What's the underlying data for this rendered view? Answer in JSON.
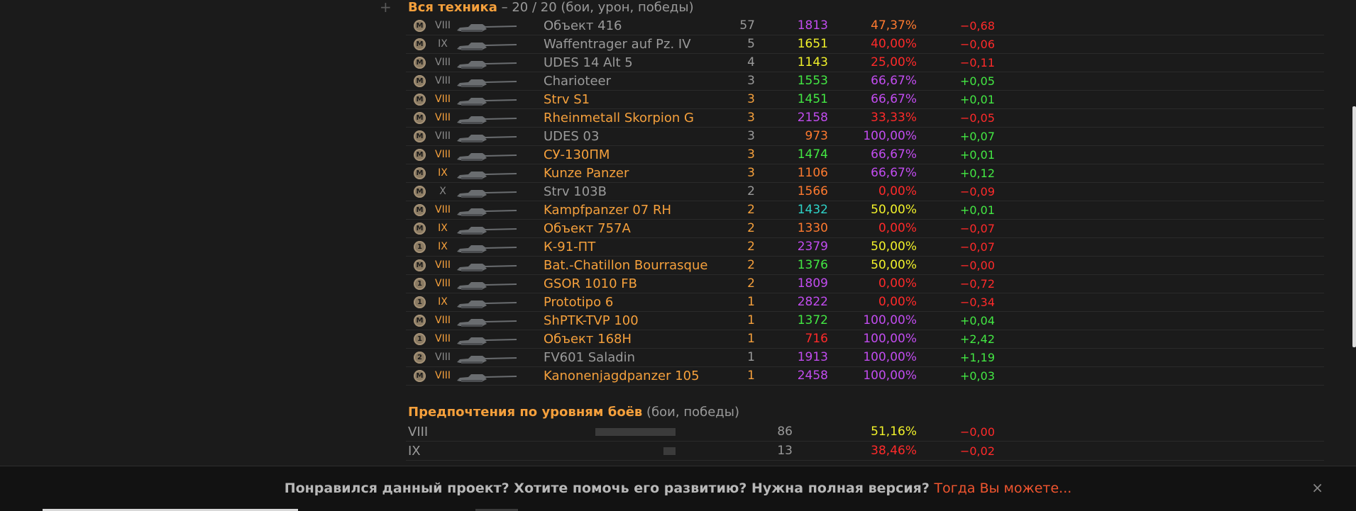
{
  "vehicles_section": {
    "plus_icon": "plus",
    "title": "Вся техника",
    "subtitle": " – 20 / 20 (бои, урон, победы)"
  },
  "vehicles": [
    {
      "medal": "M",
      "tier": "VIII",
      "name": "Объект 416",
      "battles": "57",
      "damage": "1813",
      "winrate": "47,37%",
      "delta": "−0,68",
      "colors": {
        "name": "gray",
        "battles": "gray",
        "damage": "purple",
        "winrate": "orange",
        "delta": "red"
      }
    },
    {
      "medal": "M",
      "tier": "IX",
      "name": "Waffentrager auf Pz. IV",
      "battles": "5",
      "damage": "1651",
      "winrate": "40,00%",
      "delta": "−0,06",
      "colors": {
        "name": "gray",
        "battles": "gray",
        "damage": "yellow",
        "winrate": "red",
        "delta": "red"
      }
    },
    {
      "medal": "M",
      "tier": "VIII",
      "name": "UDES 14 Alt 5",
      "battles": "4",
      "damage": "1143",
      "winrate": "25,00%",
      "delta": "−0,11",
      "colors": {
        "name": "gray",
        "battles": "gray",
        "damage": "yellow",
        "winrate": "red",
        "delta": "red"
      }
    },
    {
      "medal": "M",
      "tier": "VIII",
      "name": "Charioteer",
      "battles": "3",
      "damage": "1553",
      "winrate": "66,67%",
      "delta": "+0,05",
      "colors": {
        "name": "gray",
        "battles": "gray",
        "damage": "green",
        "winrate": "purple",
        "delta": "green"
      }
    },
    {
      "medal": "M",
      "tier": "VIII",
      "name": "Strv S1",
      "battles": "3",
      "damage": "1451",
      "winrate": "66,67%",
      "delta": "+0,01",
      "colors": {
        "name": "orange",
        "battles": "orange",
        "damage": "green",
        "winrate": "purple",
        "delta": "green"
      }
    },
    {
      "medal": "M",
      "tier": "VIII",
      "name": "Rheinmetall Skorpion G",
      "battles": "3",
      "damage": "2158",
      "winrate": "33,33%",
      "delta": "−0,05",
      "colors": {
        "name": "orange",
        "battles": "orange",
        "damage": "purple",
        "winrate": "red",
        "delta": "red"
      }
    },
    {
      "medal": "M",
      "tier": "VIII",
      "name": "UDES 03",
      "battles": "3",
      "damage": "973",
      "winrate": "100,00%",
      "delta": "+0,07",
      "colors": {
        "name": "gray",
        "battles": "gray",
        "damage": "orange",
        "winrate": "purple",
        "delta": "green"
      }
    },
    {
      "medal": "M",
      "tier": "VIII",
      "name": "СУ-130ПМ",
      "battles": "3",
      "damage": "1474",
      "winrate": "66,67%",
      "delta": "+0,01",
      "colors": {
        "name": "orange",
        "battles": "orange",
        "damage": "green",
        "winrate": "purple",
        "delta": "green"
      }
    },
    {
      "medal": "M",
      "tier": "IX",
      "name": "Kunze Panzer",
      "battles": "3",
      "damage": "1106",
      "winrate": "66,67%",
      "delta": "+0,12",
      "colors": {
        "name": "orange",
        "battles": "orange",
        "damage": "orange",
        "winrate": "purple",
        "delta": "green"
      }
    },
    {
      "medal": "M",
      "tier": "X",
      "name": "Strv 103B",
      "battles": "2",
      "damage": "1566",
      "winrate": "0,00%",
      "delta": "−0,09",
      "colors": {
        "name": "gray",
        "battles": "gray",
        "damage": "orange",
        "winrate": "red",
        "delta": "red"
      }
    },
    {
      "medal": "M",
      "tier": "VIII",
      "name": "Kampfpanzer 07 RH",
      "battles": "2",
      "damage": "1432",
      "winrate": "50,00%",
      "delta": "+0,01",
      "colors": {
        "name": "orange",
        "battles": "orange",
        "damage": "teal",
        "winrate": "yellow",
        "delta": "green"
      }
    },
    {
      "medal": "M",
      "tier": "IX",
      "name": "Объект 757А",
      "battles": "2",
      "damage": "1330",
      "winrate": "0,00%",
      "delta": "−0,07",
      "colors": {
        "name": "orange",
        "battles": "orange",
        "damage": "orange",
        "winrate": "red",
        "delta": "red"
      }
    },
    {
      "medal": "1",
      "tier": "IX",
      "name": "К-91-ПТ",
      "battles": "2",
      "damage": "2379",
      "winrate": "50,00%",
      "delta": "−0,07",
      "colors": {
        "name": "orange",
        "battles": "orange",
        "damage": "purple",
        "winrate": "yellow",
        "delta": "red"
      }
    },
    {
      "medal": "M",
      "tier": "VIII",
      "name": "Bat.-Chatillon Bourrasque",
      "battles": "2",
      "damage": "1376",
      "winrate": "50,00%",
      "delta": "−0,00",
      "colors": {
        "name": "orange",
        "battles": "orange",
        "damage": "green",
        "winrate": "yellow",
        "delta": "red"
      }
    },
    {
      "medal": "1",
      "tier": "VIII",
      "name": "GSOR 1010 FB",
      "battles": "2",
      "damage": "1809",
      "winrate": "0,00%",
      "delta": "−0,72",
      "colors": {
        "name": "orange",
        "battles": "orange",
        "damage": "purple",
        "winrate": "red",
        "delta": "red"
      }
    },
    {
      "medal": "1",
      "tier": "IX",
      "name": "Prototipo 6",
      "battles": "1",
      "damage": "2822",
      "winrate": "0,00%",
      "delta": "−0,34",
      "colors": {
        "name": "orange",
        "battles": "orange",
        "damage": "purple",
        "winrate": "red",
        "delta": "red"
      }
    },
    {
      "medal": "M",
      "tier": "VIII",
      "name": "ShPTK-TVP 100",
      "battles": "1",
      "damage": "1372",
      "winrate": "100,00%",
      "delta": "+0,04",
      "colors": {
        "name": "orange",
        "battles": "orange",
        "damage": "green",
        "winrate": "purple",
        "delta": "green"
      }
    },
    {
      "medal": "1",
      "tier": "VIII",
      "name": "Объект 168Н",
      "battles": "1",
      "damage": "716",
      "winrate": "100,00%",
      "delta": "+2,42",
      "colors": {
        "name": "orange",
        "battles": "orange",
        "damage": "red",
        "winrate": "purple",
        "delta": "green"
      }
    },
    {
      "medal": "2",
      "tier": "VIII",
      "name": "FV601 Saladin",
      "battles": "1",
      "damage": "1913",
      "winrate": "100,00%",
      "delta": "+1,19",
      "colors": {
        "name": "gray",
        "battles": "gray",
        "damage": "purple",
        "winrate": "purple",
        "delta": "green"
      }
    },
    {
      "medal": "M",
      "tier": "VIII",
      "name": "Kanonenjagdpanzer 105",
      "battles": "1",
      "damage": "2458",
      "winrate": "100,00%",
      "delta": "+0,03",
      "colors": {
        "name": "orange",
        "battles": "orange",
        "damage": "purple",
        "winrate": "purple",
        "delta": "green"
      }
    }
  ],
  "levels_section": {
    "title": "Предпочтения по уровням боёв",
    "subtitle": " (бои, победы)"
  },
  "levels": [
    {
      "level": "VIII",
      "share": 0.87,
      "battles": "86",
      "winrate": "51,16%",
      "delta": "−0,00",
      "colors": {
        "winrate": "yellow",
        "delta": "red"
      }
    },
    {
      "level": "IX",
      "share": 0.13,
      "battles": "13",
      "winrate": "38,46%",
      "delta": "−0,02",
      "colors": {
        "winrate": "red",
        "delta": "red"
      }
    }
  ],
  "footer": {
    "text": "Понравился данный проект? Хотите помочь его развитию? Нужна полная версия? ",
    "link": "Тогда Вы можете...",
    "close_icon": "×"
  },
  "colors": {
    "gray": "#9a9a9a",
    "orange_name": "#f5a03c",
    "orange": "#ff7a2f",
    "red": "#ff2a2a",
    "yellow": "#f2f22a",
    "green": "#43e843",
    "teal": "#2ed3c8",
    "purple": "#c24cf0"
  }
}
